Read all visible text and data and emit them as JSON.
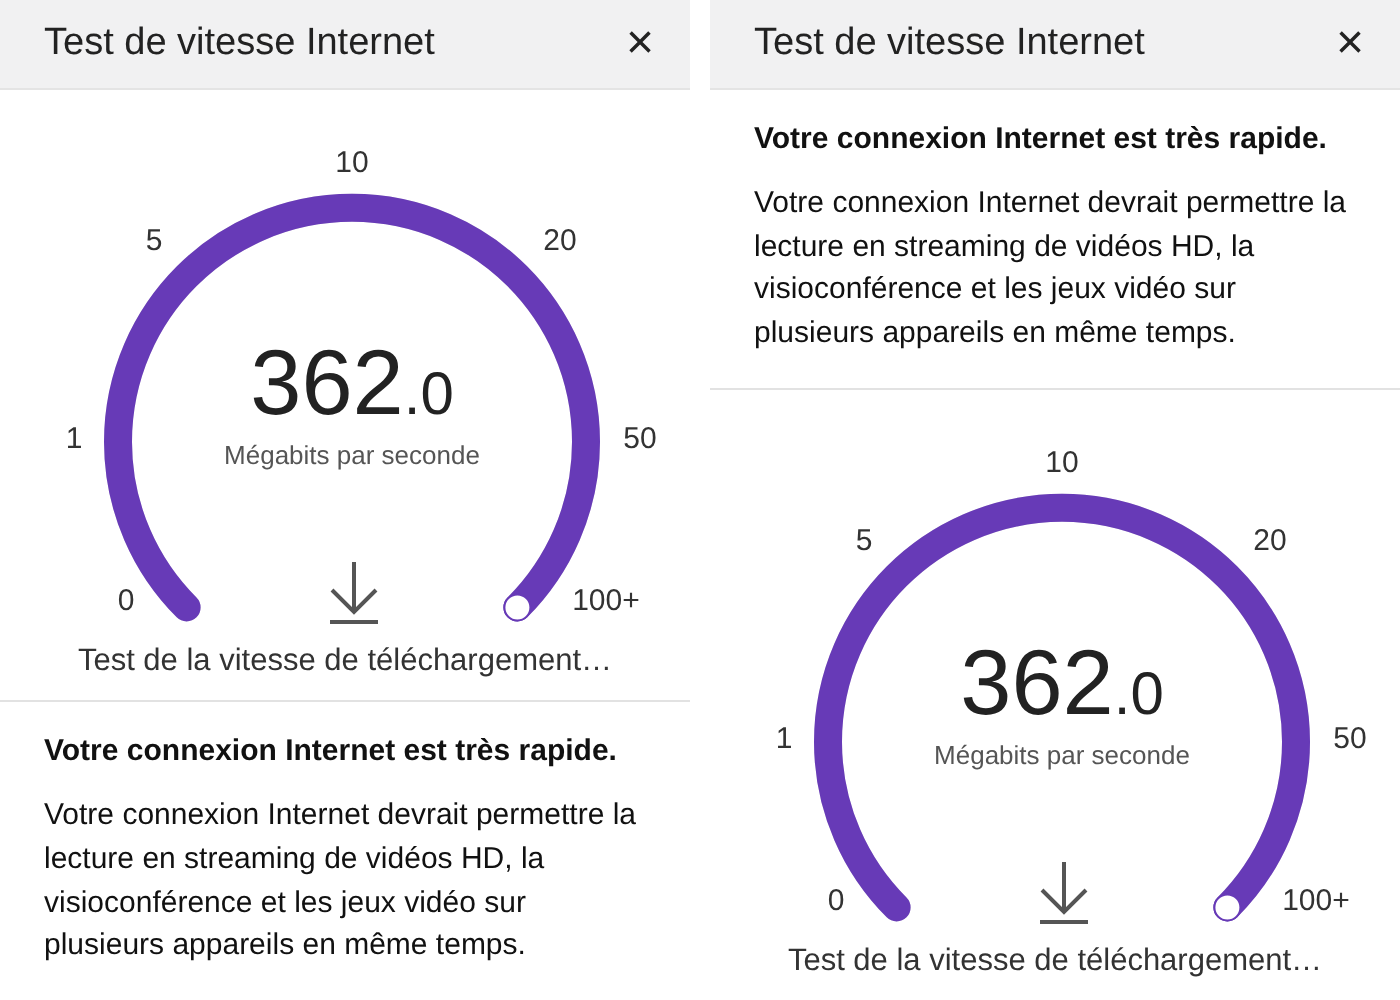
{
  "panels": [
    {
      "title": "Test de vitesse Internet",
      "close": "×",
      "sections": [
        {
          "kind": "gauge",
          "ticks": [
            "0",
            "1",
            "5",
            "10",
            "20",
            "50",
            "100+"
          ],
          "value": "362",
          "decimal": ".0",
          "unit": "Mégabits par seconde",
          "level": 1,
          "caption": "Test de la vitesse de téléchargement…"
        },
        {
          "kind": "message",
          "heading": "Votre connexion Internet est très rapide.",
          "body": "Votre connexion Internet devrait permettre la lecture en streaming de vidéos HD, la visioconférence et les jeux vidéo sur plusieurs appareils en même temps."
        }
      ]
    },
    {
      "title": "Test de vitesse Internet",
      "close": "×",
      "sections": [
        {
          "kind": "message",
          "heading": "Votre connexion Internet est très rapide.",
          "body": "Votre connexion Internet devrait permettre la lecture en streaming de vidéos HD, la visioconférence et les jeux vidéo sur plusieurs appareils en même temps."
        },
        {
          "kind": "gauge",
          "ticks": [
            "0",
            "1",
            "5",
            "10",
            "20",
            "50",
            "100+"
          ],
          "value": "362",
          "decimal": ".0",
          "unit": "Mégabits par seconde",
          "level": 1,
          "caption": "Test de la vitesse de téléchargement…"
        }
      ]
    }
  ]
}
